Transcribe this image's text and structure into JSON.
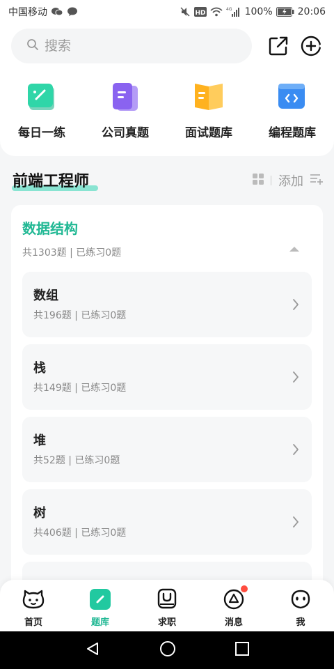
{
  "status_bar": {
    "carrier": "中国移动",
    "hd": "HD",
    "signal": "4G",
    "battery": "100%",
    "time": "20:06"
  },
  "search": {
    "placeholder": "搜索"
  },
  "quick_entries": [
    {
      "label": "每日一练",
      "icon": "daily-practice-icon",
      "color": "#2fd6a8"
    },
    {
      "label": "公司真题",
      "icon": "company-questions-icon",
      "color": "#8a63f0"
    },
    {
      "label": "面试题库",
      "icon": "interview-book-icon",
      "color": "#ffb21f"
    },
    {
      "label": "编程题库",
      "icon": "code-icon",
      "color": "#3a8cf2"
    }
  ],
  "section": {
    "title": "前端工程师",
    "add_label": "添加"
  },
  "category": {
    "title": "数据结构",
    "meta": "共1303题 | 已练习0题"
  },
  "items": [
    {
      "title": "数组",
      "meta": "共196题 | 已练习0题"
    },
    {
      "title": "栈",
      "meta": "共149题 | 已练习0题"
    },
    {
      "title": "堆",
      "meta": "共52题 | 已练习0题"
    },
    {
      "title": "树",
      "meta": "共406题 | 已练习0题"
    }
  ],
  "tabs": [
    {
      "label": "首页",
      "active": false
    },
    {
      "label": "题库",
      "active": true
    },
    {
      "label": "求职",
      "active": false
    },
    {
      "label": "消息",
      "active": false,
      "badge": true
    },
    {
      "label": "我",
      "active": false
    }
  ],
  "colors": {
    "accent": "#21b894",
    "badge": "#ff4d3f"
  }
}
